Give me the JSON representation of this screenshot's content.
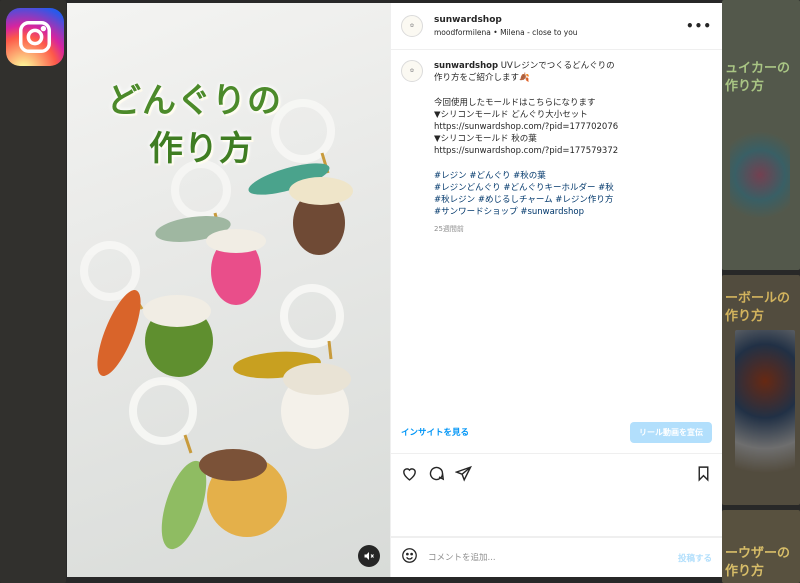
{
  "background": {
    "right_tiles": [
      {
        "text": "ュイカーの\n作り方",
        "color": "#c7e9b0"
      },
      {
        "text": "ーボールの\n作り方",
        "color": "#e8c86b"
      },
      {
        "text": "ーウザーの\n作り方",
        "color": "#f2d27c"
      }
    ]
  },
  "post": {
    "media": {
      "title_line1": "どんぐりの",
      "title_line2": "作り方"
    },
    "header": {
      "username": "sunwardshop",
      "audio_user": "moodformilena",
      "separator": "•",
      "audio_track": "Milena - close to you",
      "more": "•••"
    },
    "caption": {
      "username": "sunwardshop",
      "text": " UVレジンでつくるどんぐりの\n作り方をご紹介します🍂\n\n今回使用したモールドはこちらになります\n▼シリコンモールド どんぐり大小セット\nhttps://sunwardshop.com/?pid=177702076\n▼シリコンモールド 秋の葉\nhttps://sunwardshop.com/?pid=177579372",
      "hashtags": "#レジン #どんぐり #秋の葉\n#レジンどんぐり #どんぐりキーホルダー #秋\n#秋レジン #めじるしチャーム #レジン作り方\n#サンワードショップ #sunwardshop",
      "time_ago": "25週間前"
    },
    "insight_label": "インサイトを見る",
    "promote_label": "リール動画を宣伝",
    "comment": {
      "placeholder": "コメントを追加...",
      "post_label": "投稿する"
    }
  },
  "colors": {
    "accent": "#0095f6",
    "accent_disabled": "#b2dffc",
    "title_green": "#4c8a2a",
    "link": "#00376b"
  }
}
